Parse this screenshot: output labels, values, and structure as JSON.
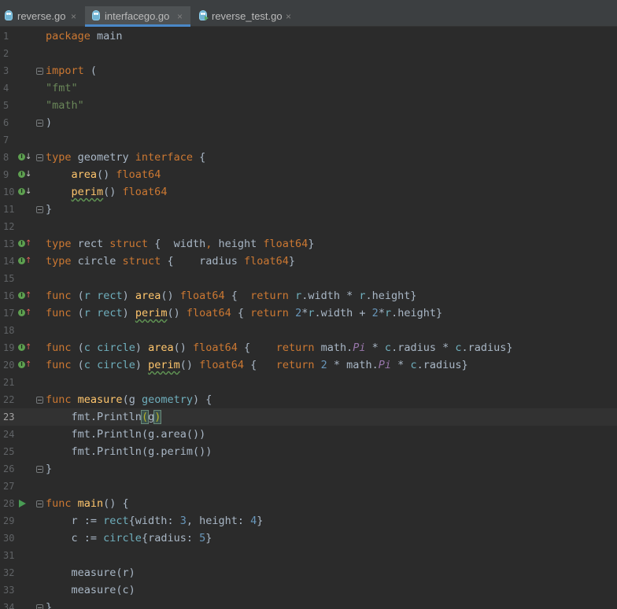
{
  "tabs": [
    {
      "label": "reverse.go",
      "active": false,
      "close": "×"
    },
    {
      "label": "interfacego.go",
      "active": true,
      "close": "×"
    },
    {
      "label": "reverse_test.go",
      "active": false,
      "close": "×"
    }
  ],
  "editor": {
    "current_line": 23,
    "lines": [
      {
        "n": "1"
      },
      {
        "n": "2"
      },
      {
        "n": "3"
      },
      {
        "n": "4"
      },
      {
        "n": "5"
      },
      {
        "n": "6"
      },
      {
        "n": "7"
      },
      {
        "n": "8"
      },
      {
        "n": "9"
      },
      {
        "n": "10"
      },
      {
        "n": "11"
      },
      {
        "n": "12"
      },
      {
        "n": "13"
      },
      {
        "n": "14"
      },
      {
        "n": "15"
      },
      {
        "n": "16"
      },
      {
        "n": "17"
      },
      {
        "n": "18"
      },
      {
        "n": "19"
      },
      {
        "n": "20"
      },
      {
        "n": "21"
      },
      {
        "n": "22"
      },
      {
        "n": "23"
      },
      {
        "n": "24"
      },
      {
        "n": "25"
      },
      {
        "n": "26"
      },
      {
        "n": "27"
      },
      {
        "n": "28"
      },
      {
        "n": "29"
      },
      {
        "n": "30"
      },
      {
        "n": "31"
      },
      {
        "n": "32"
      },
      {
        "n": "33"
      },
      {
        "n": "34"
      }
    ],
    "code": {
      "l1": [
        "package",
        " main"
      ],
      "l3": [
        "import",
        " ("
      ],
      "l4": [
        "\"fmt\""
      ],
      "l5": [
        "\"math\""
      ],
      "l6": [
        ")"
      ],
      "l8": [
        "type",
        " geometry ",
        "interface",
        " {"
      ],
      "l9": [
        "    ",
        "area",
        "() ",
        "float64"
      ],
      "l10": [
        "    ",
        "perim",
        "() ",
        "float64"
      ],
      "l11": [
        "}"
      ],
      "l13": [
        "type",
        " rect ",
        "struct",
        " {  width",
        ",",
        " height ",
        "float64",
        "}"
      ],
      "l14": [
        "type",
        " circle ",
        "struct",
        " {    radius ",
        "float64",
        "}"
      ],
      "l16": [
        "func",
        " (",
        "r",
        " ",
        "rect",
        ") ",
        "area",
        "() ",
        "float64",
        " {  ",
        "return",
        " ",
        "r",
        ".width * ",
        "r",
        ".height}"
      ],
      "l17": [
        "func",
        " (",
        "r",
        " ",
        "rect",
        ") ",
        "perim",
        "() ",
        "float64",
        " { ",
        "return",
        " ",
        "2",
        "*",
        "r",
        ".width + ",
        "2",
        "*",
        "r",
        ".height}"
      ],
      "l19": [
        "func",
        " (",
        "c",
        " ",
        "circle",
        ") ",
        "area",
        "() ",
        "float64",
        " {    ",
        "return",
        " math.",
        "Pi",
        " * ",
        "c",
        ".radius * ",
        "c",
        ".radius}"
      ],
      "l20": [
        "func",
        " (",
        "c",
        " ",
        "circle",
        ") ",
        "perim",
        "() ",
        "float64",
        " {   ",
        "return",
        " ",
        "2",
        " * math.",
        "Pi",
        " * ",
        "c",
        ".radius}"
      ],
      "l22": [
        "func",
        " ",
        "measure",
        "(g ",
        "geometry",
        ") {"
      ],
      "l23": [
        "    fmt.",
        "Println",
        "(",
        "g",
        ")"
      ],
      "l24": [
        "    fmt.",
        "Println",
        "(g.area())"
      ],
      "l25": [
        "    fmt.",
        "Println",
        "(g.perim())"
      ],
      "l26": [
        "}"
      ],
      "l28": [
        "func",
        " ",
        "main",
        "() {"
      ],
      "l29": [
        "    r := ",
        "rect",
        "{width: ",
        "3",
        ", height: ",
        "4",
        "}"
      ],
      "l30": [
        "    c := ",
        "circle",
        "{radius: ",
        "5",
        "}"
      ],
      "l32": [
        "    measure(r)"
      ],
      "l33": [
        "    measure(c)"
      ],
      "l34": [
        "}"
      ]
    },
    "gutter_icons": {
      "implemented": "I",
      "arrow_down": "↓",
      "arrow_up": "↑"
    }
  },
  "colors": {
    "background": "#2b2b2b",
    "keyword": "#cc7832",
    "string": "#6a8759",
    "number": "#6897bb",
    "function": "#ffc66d",
    "type": "#6fafbd",
    "accent_tab": "#4a88c7"
  }
}
